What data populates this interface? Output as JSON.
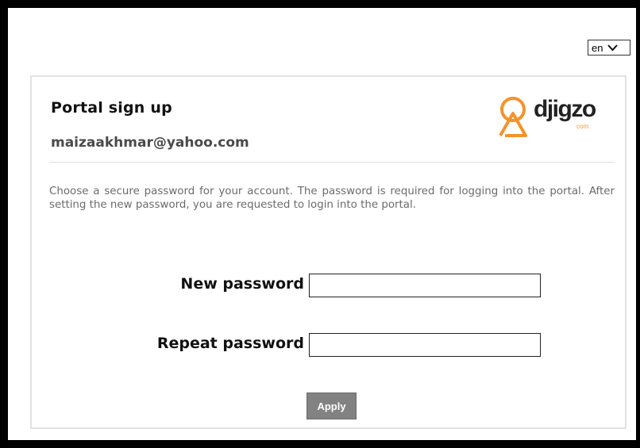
{
  "language": {
    "selected": "en"
  },
  "form": {
    "title": "Portal sign up",
    "email": "maizaakhmar@yahoo.com",
    "intro": "Choose a secure password for your account. The password is required for logging into the portal. After setting the new password, you are requested to login into the portal.",
    "new_password_label": "New password",
    "repeat_password_label": "Repeat password",
    "apply_label": "Apply"
  },
  "logo": {
    "wordmark": "djigzo",
    "suffix": "com"
  },
  "colors": {
    "brand_orange": "#f4932a",
    "button_gray": "#828282"
  }
}
